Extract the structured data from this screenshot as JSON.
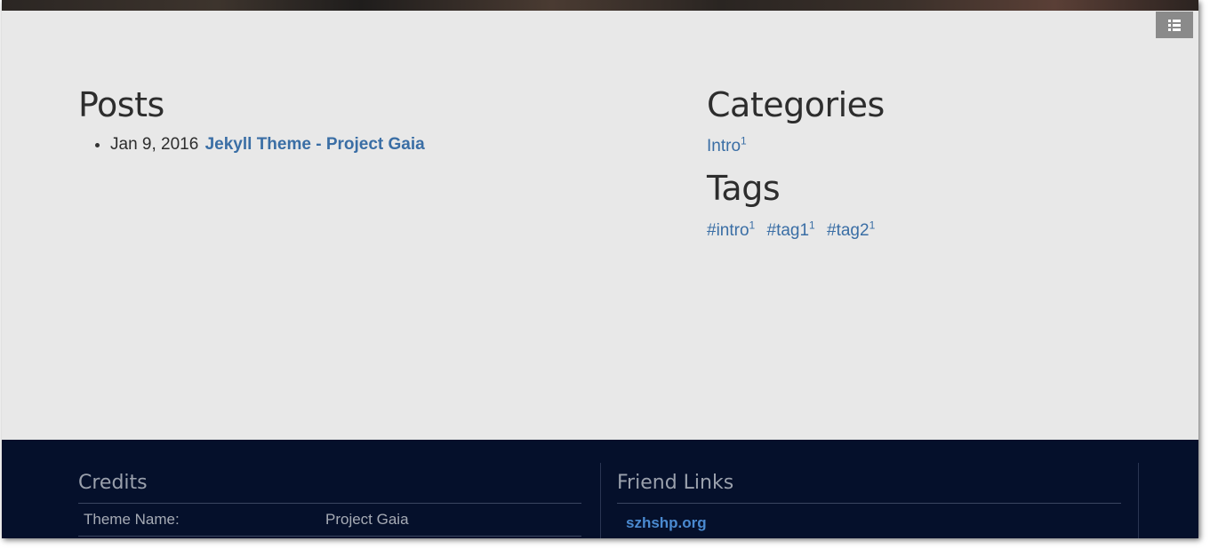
{
  "menu": {
    "icon": "list-icon"
  },
  "posts": {
    "title": "Posts",
    "items": [
      {
        "date": "Jan 9, 2016",
        "title": "Jekyll Theme - Project Gaia"
      }
    ]
  },
  "categories": {
    "title": "Categories",
    "items": [
      {
        "name": "Intro",
        "count": "1"
      }
    ]
  },
  "tags": {
    "title": "Tags",
    "items": [
      {
        "name": "#intro",
        "count": "1"
      },
      {
        "name": "#tag1",
        "count": "1"
      },
      {
        "name": "#tag2",
        "count": "1"
      }
    ]
  },
  "footer": {
    "credits": {
      "title": "Credits",
      "rows": [
        {
          "key": "Theme Name:",
          "value": "Project Gaia"
        }
      ]
    },
    "friends": {
      "title": "Friend Links",
      "links": [
        "szhshp.org"
      ]
    }
  },
  "colors": {
    "background": "#e8e8e8",
    "link": "#3a6ea5",
    "footer": "#05102b",
    "footer_link": "#4a8ad0"
  }
}
